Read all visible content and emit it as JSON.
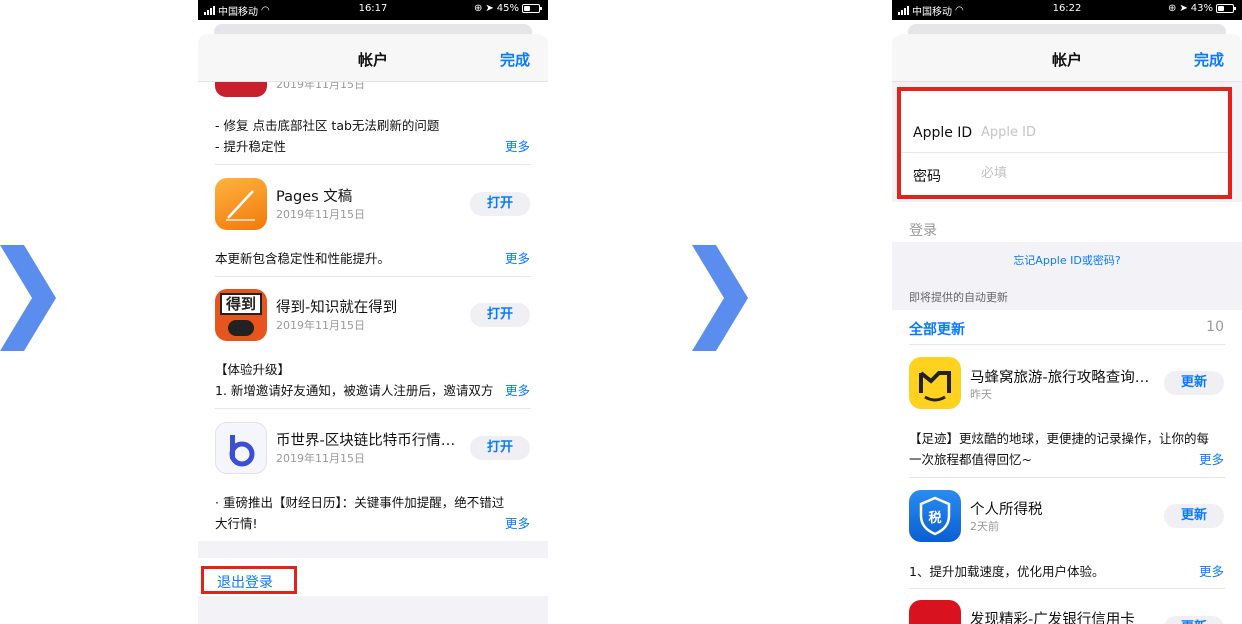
{
  "colors": {
    "accent": "#0a7aff",
    "highlight": "#e2231a",
    "arrow": "#5b8def"
  },
  "left": {
    "status": {
      "carrier": "中国移动",
      "time": "16:17",
      "battery": "45%",
      "battery_level": 0.45
    },
    "nav": {
      "title": "帐户",
      "done": "完成"
    },
    "top_item": {
      "date": "2019年11月15日",
      "notes": [
        "- 修复 点击底部社区 tab无法刷新的问题",
        "- 提升稳定性"
      ],
      "more": "更多"
    },
    "apps": [
      {
        "name": "Pages 文稿",
        "date": "2019年11月15日",
        "button": "打开",
        "notes": [
          "本更新包含稳定性和性能提升。"
        ],
        "more": "更多",
        "icon": "pages-icon"
      },
      {
        "name": "得到-知识就在得到",
        "date": "2019年11月15日",
        "button": "打开",
        "notes": [
          "【体验升级】",
          "1. 新增邀请好友通知，被邀请人注册后，邀请双方"
        ],
        "more": "更多",
        "icon": "dedao-icon",
        "icon_text": "得到"
      },
      {
        "name": "币世界-区块链比特币行情…",
        "date": "2019年11月15日",
        "button": "打开",
        "notes": [
          "· 重磅推出【财经日历】：关键事件加提醒，绝不错过",
          "大行情!"
        ],
        "more": "更多",
        "icon": "bishijie-icon"
      }
    ],
    "signout": "退出登录"
  },
  "right": {
    "status": {
      "carrier": "中国移动",
      "time": "16:22",
      "battery": "43%",
      "battery_level": 0.43
    },
    "nav": {
      "title": "帐户",
      "done": "完成"
    },
    "form": {
      "apple_id_label": "Apple ID",
      "apple_id_placeholder": "Apple ID",
      "password_label": "密码",
      "password_placeholder": "必填"
    },
    "login": "登录",
    "forgot": "忘记Apple ID或密码?",
    "section_header": "即将提供的自动更新",
    "update_all": "全部更新",
    "update_count": "10",
    "apps": [
      {
        "name": "马蜂窝旅游-旅行攻略查询…",
        "date": "昨天",
        "button": "更新",
        "notes": [
          "【足迹】更炫酷的地球，更便捷的记录操作，让你的每",
          "一次旅程都值得回忆~"
        ],
        "more": "更多",
        "icon": "mafengwo-icon"
      },
      {
        "name": "个人所得税",
        "date": "2天前",
        "button": "更新",
        "notes": [
          "1、提升加载速度，优化用户体验。"
        ],
        "more": "更多",
        "icon": "tax-icon",
        "icon_text": "税"
      },
      {
        "name": "发现精彩-广发银行信用卡",
        "button": "更新",
        "icon": "cgb-icon"
      }
    ]
  }
}
